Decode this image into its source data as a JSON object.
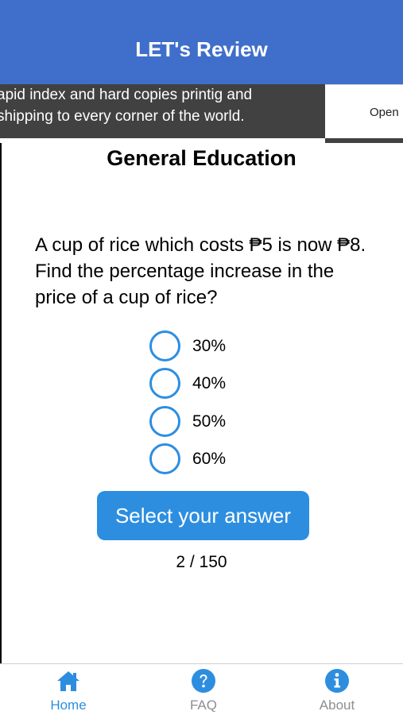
{
  "header": {
    "title": "LET's Review"
  },
  "ad": {
    "text_line1": "apid index and hard copies printig and",
    "text_line2": "shipping to every corner of the world.",
    "open_label": "Open"
  },
  "section": {
    "title": "General Education"
  },
  "question": {
    "text": "A cup of rice which costs ₱5 is now ₱8. Find the percentage increase in the price of a cup of rice?"
  },
  "options": [
    {
      "label": "30%"
    },
    {
      "label": "40%"
    },
    {
      "label": "50%"
    },
    {
      "label": "60%"
    }
  ],
  "answer_button": {
    "label": "Select your answer"
  },
  "progress": {
    "counter": "2 / 150"
  },
  "tabbar": {
    "items": [
      {
        "label": "Home",
        "icon": "home-icon",
        "active": true
      },
      {
        "label": "FAQ",
        "icon": "question-circle-icon",
        "active": false
      },
      {
        "label": "About",
        "icon": "info-circle-icon",
        "active": false
      }
    ]
  },
  "colors": {
    "header": "#3f6fcb",
    "accent": "#2d8ee0",
    "inactive_tab": "#8e8e93",
    "ad_background": "#414141"
  }
}
